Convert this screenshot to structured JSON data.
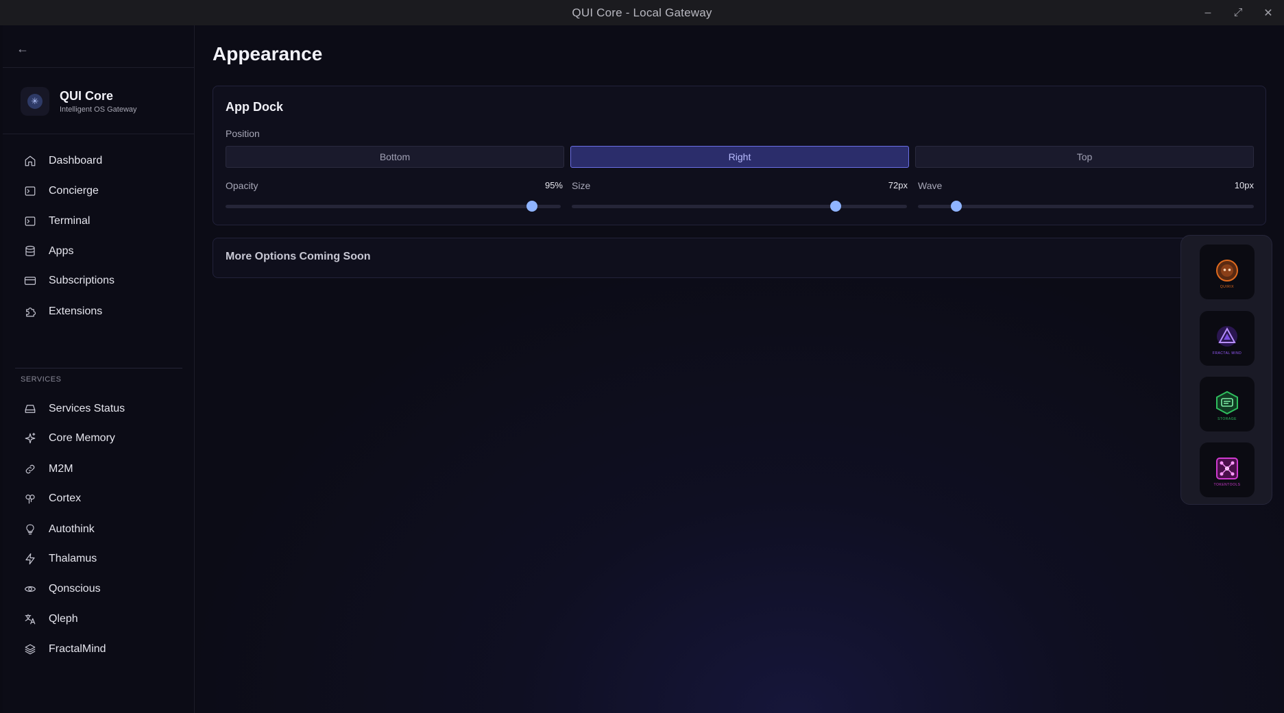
{
  "window": {
    "title": "QUI Core - Local Gateway"
  },
  "sidebar": {
    "back_label": "←",
    "brand": {
      "name": "QUI Core",
      "subtitle": "Intelligent OS Gateway"
    },
    "items": [
      {
        "label": "Dashboard",
        "icon": "home-icon"
      },
      {
        "label": "Concierge",
        "icon": "terminal-icon"
      },
      {
        "label": "Terminal",
        "icon": "terminal-icon"
      },
      {
        "label": "Apps",
        "icon": "database-icon"
      },
      {
        "label": "Subscriptions",
        "icon": "credit-card-icon"
      },
      {
        "label": "Extensions",
        "icon": "puzzle-icon"
      }
    ],
    "services_label": "SERVICES",
    "services": [
      {
        "label": "Services Status",
        "icon": "hard-drive-icon"
      },
      {
        "label": "Core Memory",
        "icon": "sparkles-icon"
      },
      {
        "label": "M2M",
        "icon": "link-icon"
      },
      {
        "label": "Cortex",
        "icon": "brain-icon"
      },
      {
        "label": "Autothink",
        "icon": "lightbulb-icon"
      },
      {
        "label": "Thalamus",
        "icon": "zap-icon"
      },
      {
        "label": "Qonscious",
        "icon": "eye-icon"
      },
      {
        "label": "Qleph",
        "icon": "languages-icon"
      },
      {
        "label": "FractalMind",
        "icon": "layers-icon"
      }
    ]
  },
  "main": {
    "title": "Appearance",
    "app_dock": {
      "title": "App Dock",
      "position_label": "Position",
      "positions": [
        "Bottom",
        "Right",
        "Top"
      ],
      "selected_position": "Right",
      "opacity": {
        "label": "Opacity",
        "value_text": "95%",
        "fraction": 0.915
      },
      "size": {
        "label": "Size",
        "value_text": "72px",
        "fraction": 0.788
      },
      "wave": {
        "label": "Wave",
        "value_text": "10px",
        "fraction": 0.115
      }
    },
    "more_options": {
      "title": "More Options Coming Soon"
    }
  },
  "dock": {
    "apps": [
      {
        "name": "app-orange",
        "label": "QUIRIX",
        "color": "#e06a1e"
      },
      {
        "name": "app-fractal-mind",
        "label": "FRACTAL MIND",
        "color": "#9a5cff"
      },
      {
        "name": "app-green",
        "label": "STORAGE",
        "color": "#2fbf5e"
      },
      {
        "name": "app-magenta",
        "label": "TOKENTOOLS",
        "color": "#d13bd1"
      }
    ]
  },
  "colors": {
    "accent": "#6b6fe6",
    "slider_thumb": "#8fb4ff"
  }
}
